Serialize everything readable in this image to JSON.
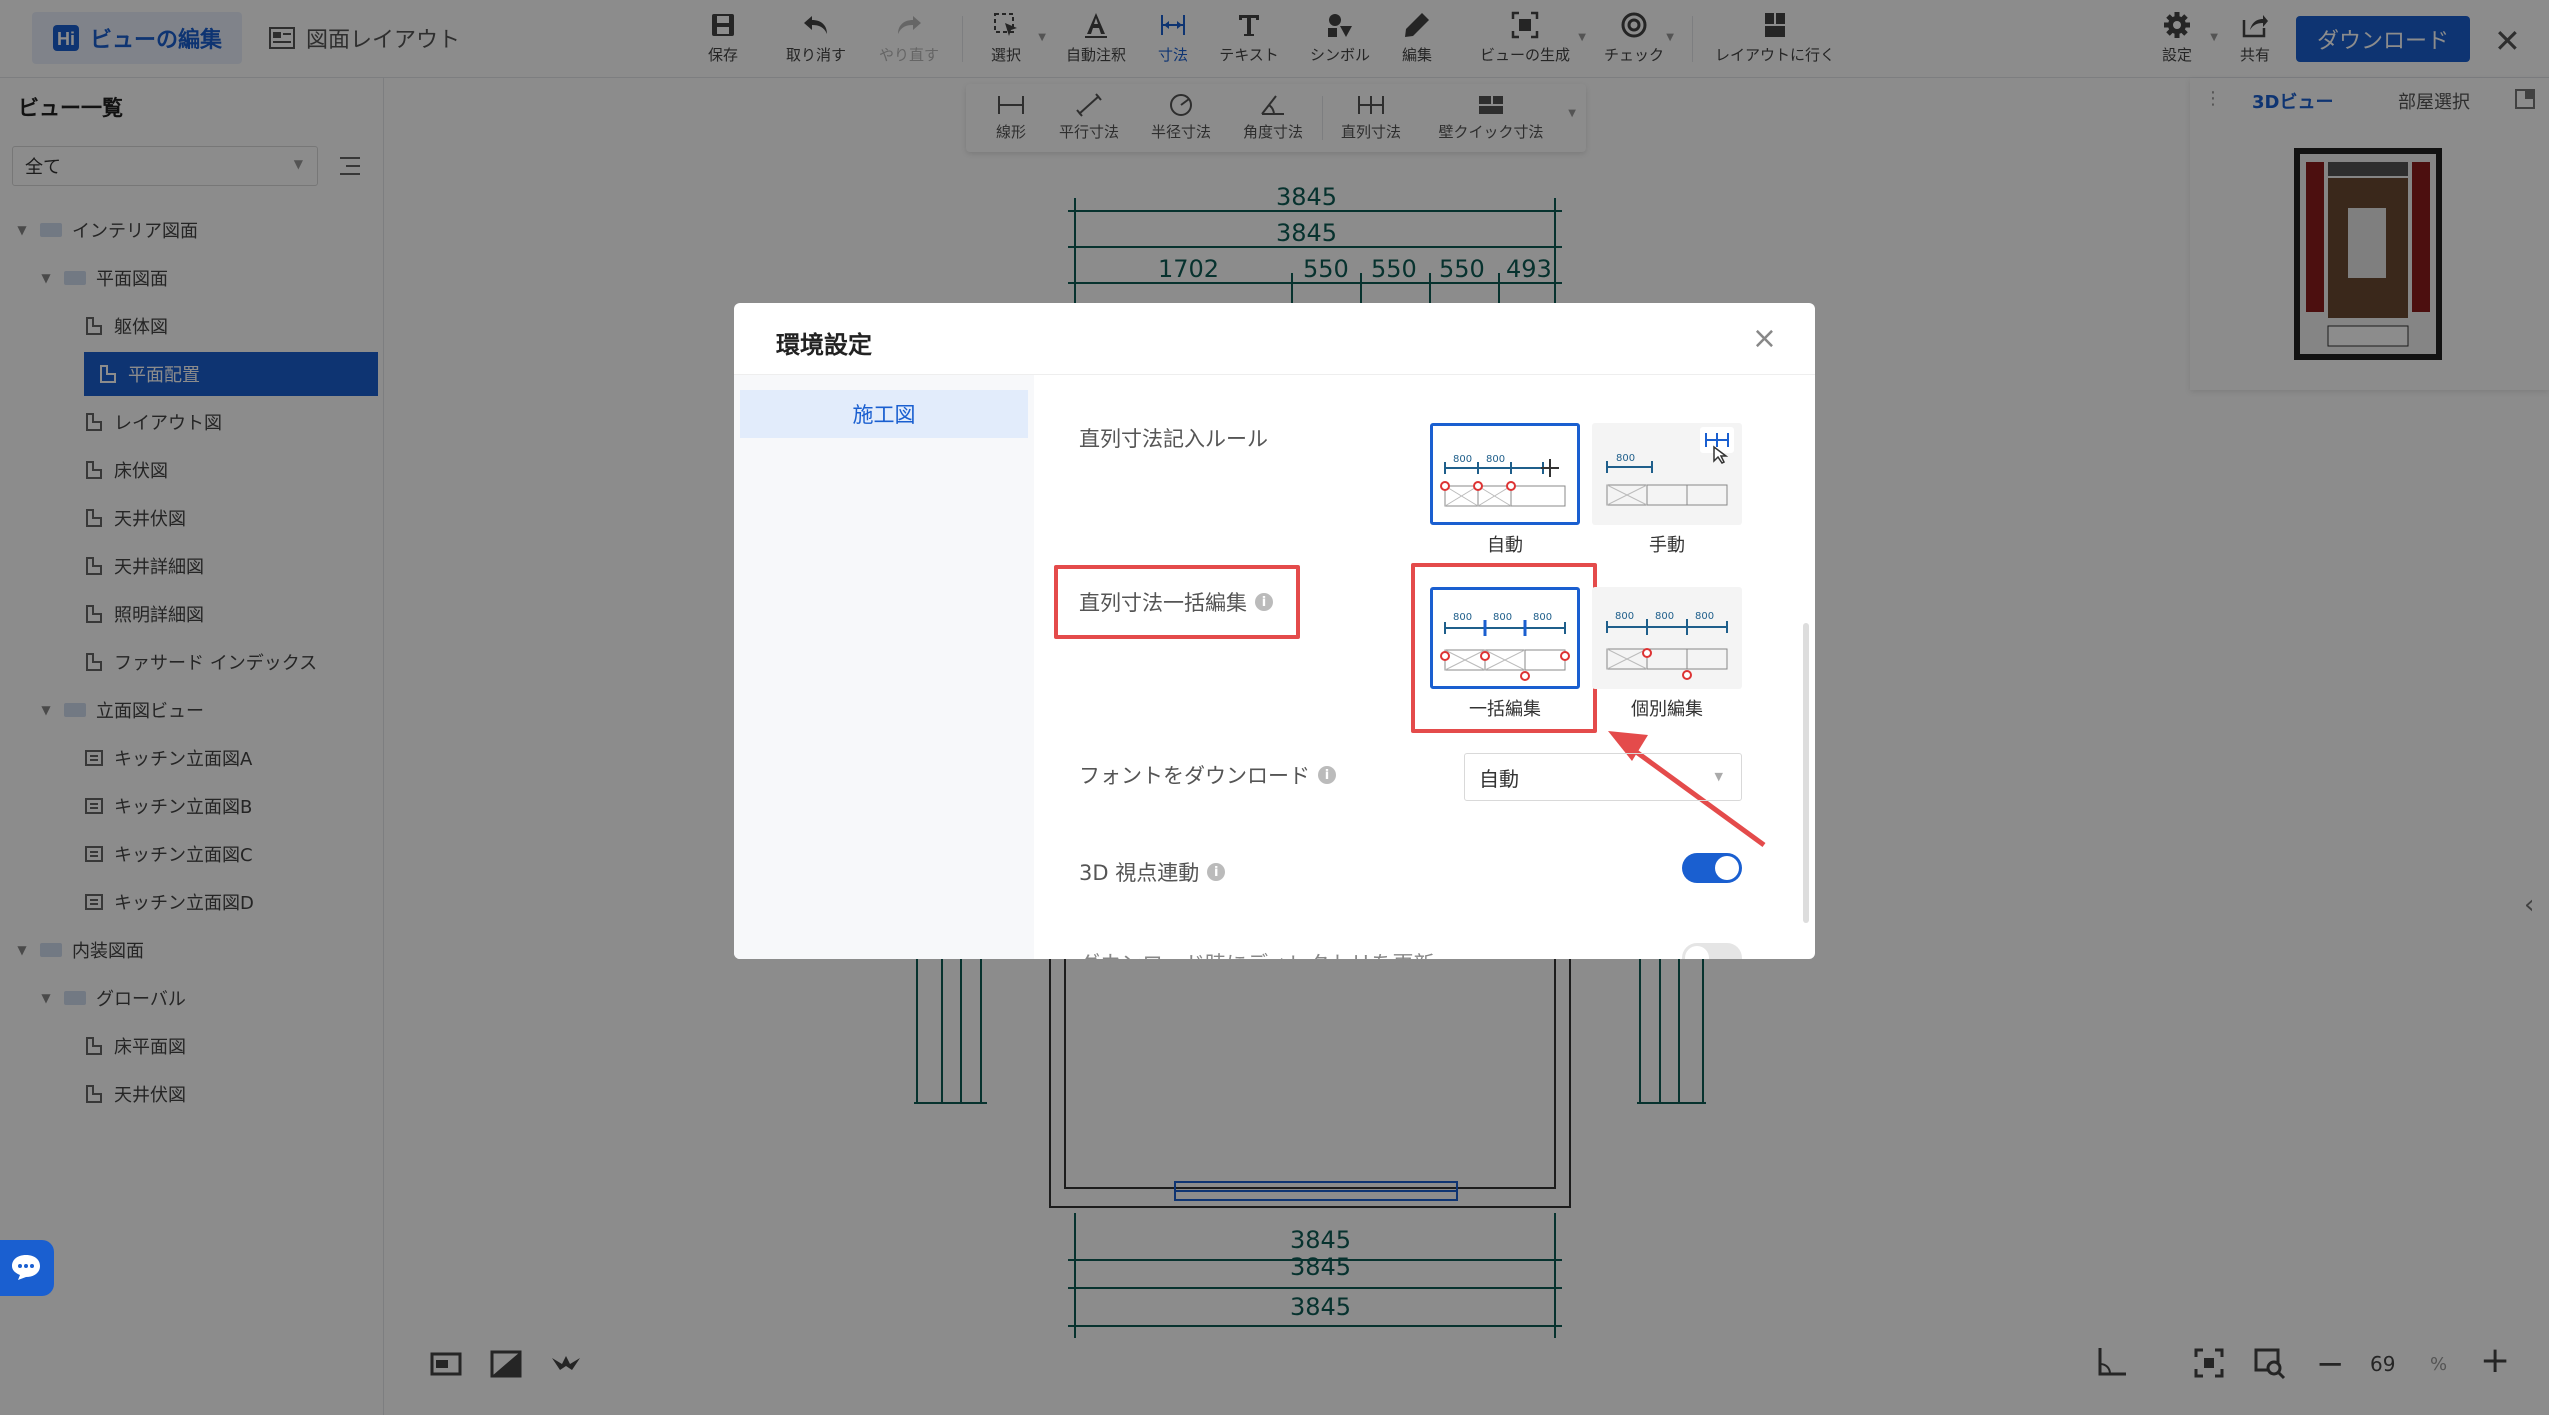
{
  "header": {
    "tab_edit": "ビューの編集",
    "tab_layout": "図面レイアウト",
    "tools": [
      {
        "label": "保存",
        "icon": "save-icon"
      },
      {
        "label": "取り消す",
        "icon": "undo-icon"
      },
      {
        "label": "やり直す",
        "icon": "redo-icon"
      },
      {
        "label": "選択",
        "icon": "select-icon"
      },
      {
        "label": "自動注釈",
        "icon": "auto-annotation-icon"
      },
      {
        "label": "寸法",
        "icon": "dimension-icon"
      },
      {
        "label": "テキスト",
        "icon": "text-icon"
      },
      {
        "label": "シンボル",
        "icon": "symbol-icon"
      },
      {
        "label": "編集",
        "icon": "edit-icon"
      },
      {
        "label": "ビューの生成",
        "icon": "generate-view-icon"
      },
      {
        "label": "チェック",
        "icon": "check-icon"
      },
      {
        "label": "レイアウトに行く",
        "icon": "goto-layout-icon"
      }
    ],
    "settings_label": "設定",
    "share_label": "共有",
    "download_label": "ダウンロード"
  },
  "dimension_subtoolbar": [
    {
      "label": "線形",
      "icon": "linear-dimension-icon"
    },
    {
      "label": "平行寸法",
      "icon": "aligned-dimension-icon"
    },
    {
      "label": "半径寸法",
      "icon": "radius-dimension-icon"
    },
    {
      "label": "角度寸法",
      "icon": "angle-dimension-icon"
    },
    {
      "label": "直列寸法",
      "icon": "serial-dimension-icon"
    },
    {
      "label": "壁クイック寸法",
      "icon": "wall-quick-dimension-icon"
    }
  ],
  "sidebar": {
    "title": "ビュー一覧",
    "filter_value": "全て",
    "tree": [
      {
        "label": "インテリア図面",
        "level": 0,
        "type": "folder"
      },
      {
        "label": "平面図面",
        "level": 1,
        "type": "folder"
      },
      {
        "label": "躯体図",
        "level": 2,
        "type": "plan"
      },
      {
        "label": "平面配置",
        "level": 2,
        "type": "plan",
        "selected": true
      },
      {
        "label": "レイアウト図",
        "level": 2,
        "type": "plan"
      },
      {
        "label": "床伏図",
        "level": 2,
        "type": "plan"
      },
      {
        "label": "天井伏図",
        "level": 2,
        "type": "plan"
      },
      {
        "label": "天井詳細図",
        "level": 2,
        "type": "plan"
      },
      {
        "label": "照明詳細図",
        "level": 2,
        "type": "plan"
      },
      {
        "label": "ファサード インデックス",
        "level": 2,
        "type": "plan"
      },
      {
        "label": "立面図ビュー",
        "level": 1,
        "type": "folder"
      },
      {
        "label": "キッチン立面図A",
        "level": 2,
        "type": "elevation"
      },
      {
        "label": "キッチン立面図B",
        "level": 2,
        "type": "elevation"
      },
      {
        "label": "キッチン立面図C",
        "level": 2,
        "type": "elevation"
      },
      {
        "label": "キッチン立面図D",
        "level": 2,
        "type": "elevation"
      },
      {
        "label": "内装図面",
        "level": 0,
        "type": "folder"
      },
      {
        "label": "グローバル",
        "level": 1,
        "type": "folder"
      },
      {
        "label": "床平面図",
        "level": 2,
        "type": "plan"
      },
      {
        "label": "天井伏図",
        "level": 2,
        "type": "plan"
      }
    ]
  },
  "canvas": {
    "top_dims": [
      "3845",
      "3845",
      "1702",
      "550",
      "550",
      "550",
      "493"
    ],
    "bottom_dims": [
      "3845",
      "3845",
      "3845"
    ],
    "zoom_value": "69",
    "zoom_unit": "%"
  },
  "right_panel": {
    "tab_3d": "3Dビュー",
    "tab_room": "部屋選択"
  },
  "modal": {
    "title": "環境設定",
    "nav_item": "施工図",
    "rule_label": "直列寸法記入ルール",
    "rule_options": [
      "自動",
      "手動"
    ],
    "batch_label": "直列寸法一括編集",
    "batch_options": [
      "一括編集",
      "個別編集"
    ],
    "font_label": "フォントをダウンロード",
    "font_value": "自動",
    "sync_label": "3D 視点連動",
    "sync_on": true,
    "download_update_label": "ダウンロード時にディレクトリを更新",
    "download_update_on": false,
    "thumb_dim": "800"
  },
  "colors": {
    "accent": "#1a5fd0",
    "highlight": "#e44b4b",
    "dimension": "#0d5b55"
  }
}
